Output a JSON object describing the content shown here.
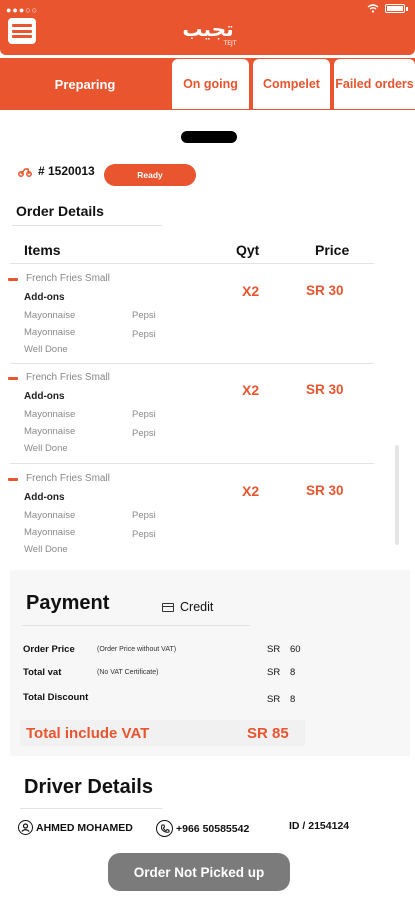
{
  "status_bar": {
    "signal": "●●●○○"
  },
  "header": {
    "logo_text": "تجيب",
    "logo_sub": "TEJT"
  },
  "tabs": [
    {
      "label": "Preparing",
      "active": true
    },
    {
      "label": "On going"
    },
    {
      "label": "Compelet"
    },
    {
      "label": "Failed orders"
    }
  ],
  "order": {
    "number": "# 1520013",
    "status": "Ready"
  },
  "order_details": {
    "title": "Order Details",
    "columns": {
      "items": "Items",
      "qty": "Qyt",
      "price": "Price"
    },
    "items": [
      {
        "name": "French Fries  Small",
        "addons_label": "Add-ons",
        "opt1": "Mayonnaise",
        "opt2": "Mayonnaise",
        "opt3": "Well Done",
        "drink1": "Pepsi",
        "drink2": "Pepsi",
        "qty": "X2",
        "price": "SR 30"
      },
      {
        "name": "French Fries  Small",
        "addons_label": "Add-ons",
        "opt1": "Mayonnaise",
        "opt2": "Mayonnaise",
        "opt3": "Well Done",
        "drink1": "Pepsi",
        "drink2": "Pepsi",
        "qty": "X2",
        "price": "SR 30"
      },
      {
        "name": "French Fries  Small",
        "addons_label": "Add-ons",
        "opt1": "Mayonnaise",
        "opt2": "Mayonnaise",
        "opt3": "Well Done",
        "drink1": "Pepsi",
        "drink2": "Pepsi",
        "qty": "X2",
        "price": "SR 30"
      }
    ]
  },
  "payment": {
    "title": "Payment",
    "method": "Credit",
    "order_price": {
      "label": "Order Price",
      "note": "(Order Price without VAT)",
      "currency": "SR",
      "value": "60"
    },
    "total_vat": {
      "label": "Total vat",
      "note": "(No VAT Certificate)",
      "currency": "SR",
      "value": "8"
    },
    "total_discount": {
      "label": "Total Discount",
      "currency": "SR",
      "value": "8"
    },
    "total": {
      "label": "Total include VAT",
      "value": "SR 85"
    }
  },
  "driver": {
    "title": "Driver Details",
    "name": "AHMED MOHAMED",
    "phone": "+966 50585542",
    "id": "ID / 2154124"
  },
  "action": {
    "label": "Order Not Picked up"
  },
  "colors": {
    "accent": "#e8552e",
    "button": "#7b7b7b"
  }
}
